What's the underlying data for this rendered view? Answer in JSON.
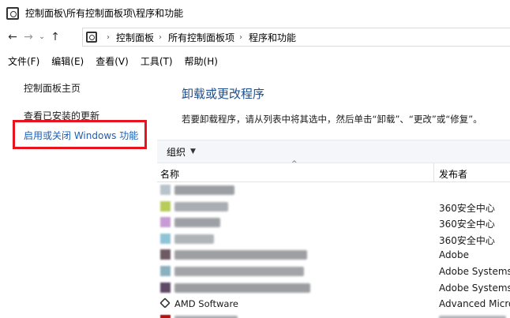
{
  "window": {
    "title": "控制面板\\所有控制面板项\\程序和功能",
    "icon": "control-panel-icon"
  },
  "address_bar": {
    "back_icon": "←",
    "forward_icon": "→",
    "recent_icon": "⌄",
    "up_icon": "↑",
    "separator": "›",
    "crumbs": [
      "控制面板",
      "所有控制面板项",
      "程序和功能"
    ]
  },
  "menu": {
    "items": [
      "文件(F)",
      "编辑(E)",
      "查看(V)",
      "工具(T)",
      "帮助(H)"
    ]
  },
  "left_pane": {
    "home_link": "控制面板主页",
    "updates_link": "查看已安装的更新",
    "features_link": "启用或关闭 Windows 功能",
    "highlight_color": "#e8141d"
  },
  "main": {
    "title": "卸载或更改程序",
    "description": "若要卸载程序，请从列表中将其选中，然后单击“卸载”、“更改”或“修复”。",
    "toolbar": {
      "organize_label": "组织",
      "organize_caret": "▼"
    },
    "columns": {
      "name": "名称",
      "publisher": "发布者",
      "sort_indicator": "^"
    },
    "rows": [
      {
        "name": "",
        "publisher": ""
      },
      {
        "name": "",
        "publisher": "360安全中心"
      },
      {
        "name": "",
        "publisher": "360安全中心"
      },
      {
        "name": "",
        "publisher": "360安全中心"
      },
      {
        "name": "",
        "publisher": "Adobe"
      },
      {
        "name": "",
        "publisher": "Adobe Systems"
      },
      {
        "name": "",
        "publisher": "Adobe Systems"
      },
      {
        "name": "AMD Software",
        "publisher": "Advanced Micro"
      },
      {
        "name": "",
        "publisher": ""
      }
    ]
  },
  "colors": {
    "title_blue": "#1e4e8c",
    "link_blue": "#1a5fb4",
    "toolbar_bg": "#f4f6f9"
  }
}
